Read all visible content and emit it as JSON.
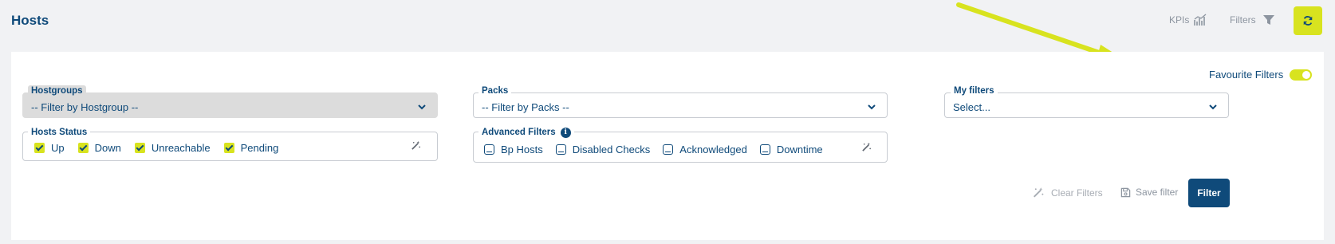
{
  "header": {
    "title": "Hosts",
    "kpis_label": "KPIs",
    "filters_label": "Filters"
  },
  "favourite": {
    "label": "Favourite Filters",
    "enabled": true
  },
  "hostgroups": {
    "label": "Hostgroups",
    "value": "-- Filter by Hostgroup --"
  },
  "packs": {
    "label": "Packs",
    "value": "-- Filter by Packs --"
  },
  "my_filters": {
    "label": "My filters",
    "value": "Select..."
  },
  "hosts_status": {
    "label": "Hosts Status",
    "items": [
      {
        "label": "Up",
        "checked": true
      },
      {
        "label": "Down",
        "checked": true
      },
      {
        "label": "Unreachable",
        "checked": true
      },
      {
        "label": "Pending",
        "checked": true
      }
    ]
  },
  "advanced_filters": {
    "label": "Advanced Filters",
    "items": [
      {
        "label": "Bp Hosts",
        "checked": false
      },
      {
        "label": "Disabled Checks",
        "checked": false
      },
      {
        "label": "Acknowledged",
        "checked": false
      },
      {
        "label": "Downtime",
        "checked": false
      }
    ]
  },
  "actions": {
    "clear_filters": "Clear Filters",
    "save_filter": "Save filter",
    "filter": "Filter"
  },
  "colors": {
    "accent": "#d8e31f",
    "primary": "#0f4a7a",
    "background": "#f1f2f4"
  }
}
